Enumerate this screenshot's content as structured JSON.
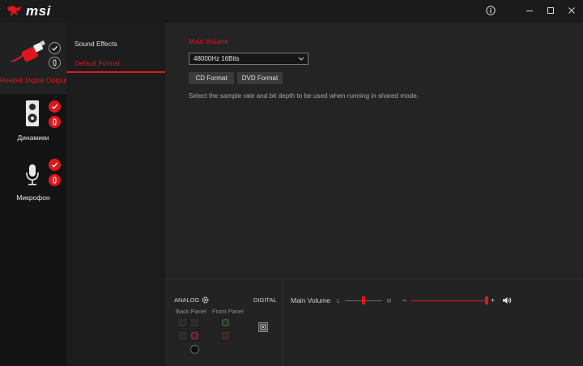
{
  "app": {
    "logo_text": "msi",
    "accent": "#e0161e",
    "icons": {
      "info": "info-icon",
      "minimize": "minimize-icon",
      "maximize": "maximize-icon",
      "close": "close-icon"
    }
  },
  "devices": [
    {
      "label": "Realtek Digital Output",
      "icon": "digital-cable-icon",
      "active": true,
      "default_badge": "check-icon",
      "settings_badge": "settings-icon"
    },
    {
      "label": "Динамики",
      "icon": "speaker-icon",
      "active": false,
      "default_badge": "check-icon",
      "settings_badge": "settings-icon"
    },
    {
      "label": "Микрофон",
      "icon": "microphone-icon",
      "active": false,
      "default_badge": "check-icon",
      "settings_badge": "settings-icon"
    }
  ],
  "subtabs": [
    {
      "label": "Sound Effects",
      "active": false
    },
    {
      "label": "Default Format",
      "active": true
    }
  ],
  "main": {
    "section_title": "Main Volume",
    "format_select": {
      "value": "48000Hz 16Bits",
      "icon": "chevron-down-icon"
    },
    "cd_button": "CD Format",
    "dvd_button": "DVD Format",
    "description": "Select the sample rate and bit depth to be used when running in shared mode."
  },
  "bottom": {
    "analog_label": "ANALOG",
    "analog_icon": "gear-icon",
    "digital_label": "DIGITAL",
    "back_panel_label": "Back Panel",
    "front_panel_label": "Front Panel",
    "digital_port_icon": "optical-port-icon",
    "volume": {
      "label": "Main Volume",
      "balance_left": "L",
      "balance_right": "R",
      "balance_position": 0.5,
      "minus": "−",
      "plus": "+",
      "level": 1.0,
      "speaker_icon": "speaker-volume-icon",
      "colors": {
        "jack_green": "#4e6a2a",
        "jack_red": "#e0161e",
        "jack_dark_red": "#6b1a1a"
      }
    }
  }
}
